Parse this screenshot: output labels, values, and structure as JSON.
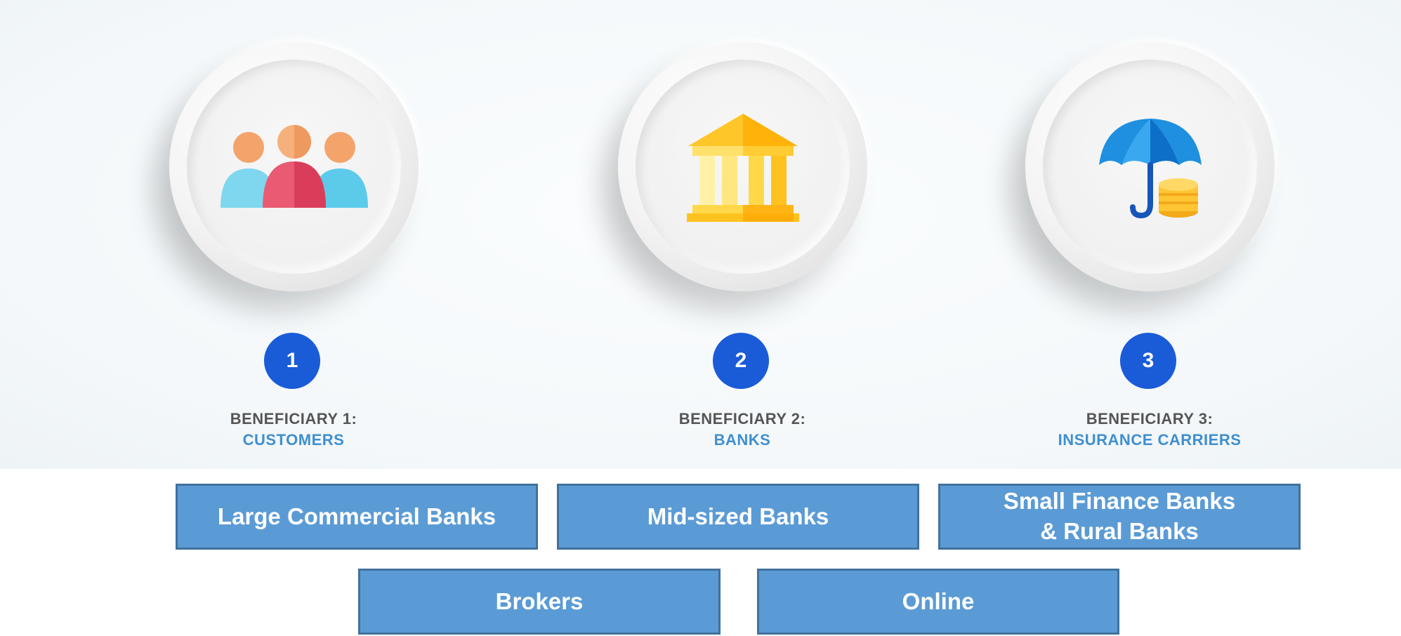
{
  "beneficiaries": [
    {
      "number": "1",
      "label": "BENEFICIARY 1:",
      "name": "CUSTOMERS",
      "icon": "people-group-icon"
    },
    {
      "number": "2",
      "label": "BENEFICIARY 2:",
      "name": "BANKS",
      "icon": "bank-building-icon"
    },
    {
      "number": "3",
      "label": "BENEFICIARY 3:",
      "name": "INSURANCE CARRIERS",
      "icon": "umbrella-coins-icon"
    }
  ],
  "boxes": {
    "row1": [
      {
        "label": "Large Commercial Banks"
      },
      {
        "label": "Mid-sized Banks"
      },
      {
        "label": "Small Finance Banks\n& Rural Banks"
      }
    ],
    "row2": [
      {
        "label": "Brokers"
      },
      {
        "label": "Online"
      }
    ]
  },
  "colors": {
    "number_badge": "#1a5bd8",
    "name_text": "#3f8fd0",
    "box_fill": "#5b9bd5",
    "box_border": "#41719c"
  }
}
